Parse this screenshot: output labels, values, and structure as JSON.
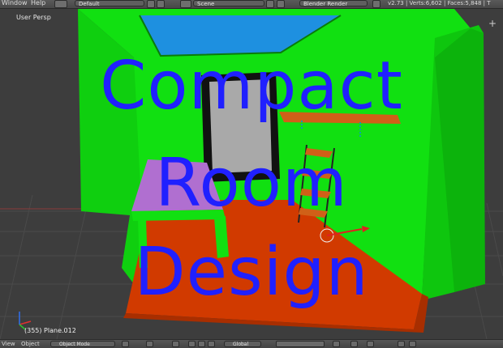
{
  "topbar": {
    "window_label": "Window",
    "help_label": "Help",
    "layout_value": "Default",
    "scene_value": "Scene",
    "render_engine": "Blender Render",
    "stats": "v2.73 | Verts:6,602 | Faces:5,848 | T"
  },
  "viewport": {
    "view_label": "User Persp",
    "object_label": "(355) Plane.012"
  },
  "overlay_title": {
    "line1": "Compact",
    "line2": "Room",
    "line3": "Design"
  },
  "bottombar": {
    "view_label": "View",
    "object_label": "Object",
    "mode_value": "Object Mode",
    "orientation_value": "Global"
  },
  "colors": {
    "wall": "#11e011",
    "floor": "#d13a00",
    "ceiling": "#1e90e0",
    "table_top": "#b06fd0",
    "title": "#2020ff"
  },
  "icons": [
    "add-icon",
    "close-icon",
    "plus-icon",
    "axis-gizmo-icon",
    "mode-icon",
    "shading-sphere-icon",
    "pivot-icon",
    "manipulator-icon",
    "layers-icon"
  ]
}
